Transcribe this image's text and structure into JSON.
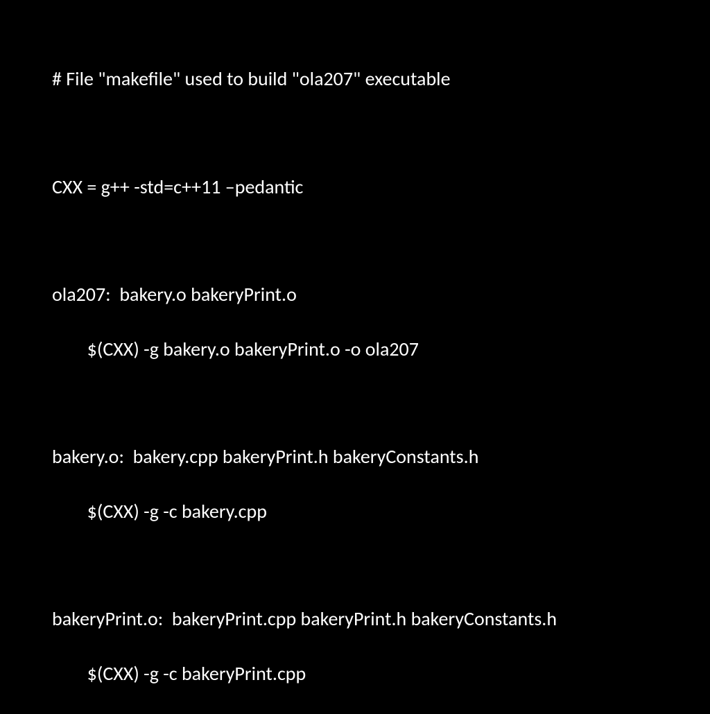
{
  "makefile": {
    "comment": "# File \"makefile\" used to build \"ola207\" executable",
    "variable": "CXX = g++ -std=c++11 –pedantic",
    "rule1_target": "ola207:  bakery.o bakeryPrint.o",
    "rule1_command": "        $(CXX) -g bakery.o bakeryPrint.o -o ola207",
    "rule2_target": "bakery.o:  bakery.cpp bakeryPrint.h bakeryConstants.h",
    "rule2_command": "        $(CXX) -g -c bakery.cpp",
    "rule3_target": "bakeryPrint.o:  bakeryPrint.cpp bakeryPrint.h bakeryConstants.h",
    "rule3_command": "        $(CXX) -g -c bakeryPrint.cpp"
  }
}
